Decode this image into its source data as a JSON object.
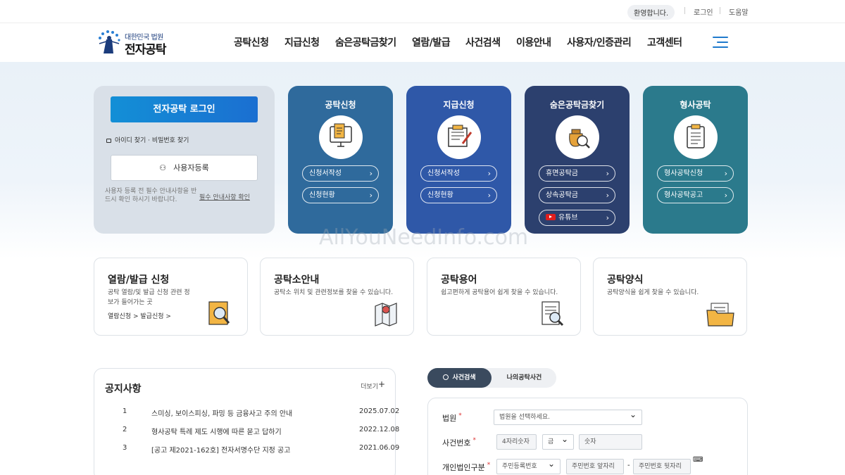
{
  "topbar": {
    "welcome": "환영합니다.",
    "login": "로그인",
    "help": "도움말"
  },
  "logo": {
    "small": "대한민국 법원",
    "big": "전자공탁"
  },
  "nav": [
    "공탁신청",
    "지급신청",
    "숨은공탁금찾기",
    "열람/발급",
    "사건검색",
    "이용안내",
    "사용자/인증관리",
    "고객센터"
  ],
  "login": {
    "button": "전자공탁 로그인",
    "find": "아이디 찾기 · 비밀번호 찾기",
    "register": "사용자등록",
    "notice": "사용자 등록 전 필수 안내사항을 반드시 확인 하시기 바랍니다.",
    "notice_link": "필수 안내사항 확인"
  },
  "cards": [
    {
      "title": "공탁신청",
      "color": "#2f6a9c",
      "links": [
        "신청서작성",
        "신청현황"
      ]
    },
    {
      "title": "지급신청",
      "color": "#2f58a8",
      "links": [
        "신청서작성",
        "신청현황"
      ]
    },
    {
      "title": "숨은공탁금찾기",
      "color": "#2c406e",
      "links": [
        "휴면공탁금",
        "상속공탁금",
        "유튜브"
      ]
    },
    {
      "title": "형사공탁",
      "color": "#2b7a8c",
      "links": [
        "형사공탁신청",
        "형사공탁공고"
      ]
    }
  ],
  "watermark": "AllYouNeedInfo.com",
  "services": [
    {
      "title": "열람/발급 신청",
      "desc": "공탁 열람/및 발급 신청 관련 정보가 들어가는 곳",
      "links": "열람신청 > 발급신청 >"
    },
    {
      "title": "공탁소안내",
      "desc": "공탁소 위치 및 관련정보를 찾을 수 있습니다."
    },
    {
      "title": "공탁용어",
      "desc": "쉽고편하게 공탁용어 쉽게 찾을 수 있습니다."
    },
    {
      "title": "공탁양식",
      "desc": "공탁양식을 쉽게 찾을 수 있습니다."
    }
  ],
  "notices": {
    "title": "공지사항",
    "more": "더보기",
    "plus": "+",
    "items": [
      {
        "n": "1",
        "s": "스미싱, 보이스피싱, 파밍 등 금융사고 주의 안내",
        "d": "2025.07.02"
      },
      {
        "n": "2",
        "s": "형사공탁 특례 제도 시행에 따른 묻고 답하기",
        "d": "2022.12.08"
      },
      {
        "n": "3",
        "s": "[공고 제2021-162호] 전자서명수단 지정 공고",
        "d": "2021.06.09"
      }
    ]
  },
  "search": {
    "tab1": "사건검색",
    "tab2": "나의공탁사건",
    "court_label": "법원",
    "court_value": "법원을 선택하세요.",
    "case_label": "사건번호",
    "year_ph": "4자리숫자",
    "kind_value": "금",
    "num_ph": "숫자",
    "type_label": "개인법인구분",
    "type_value": "주민등록번호",
    "front_ph": "주민번호 앞자리",
    "dash": "-",
    "back_ph": "주민번호 뒷자리"
  }
}
